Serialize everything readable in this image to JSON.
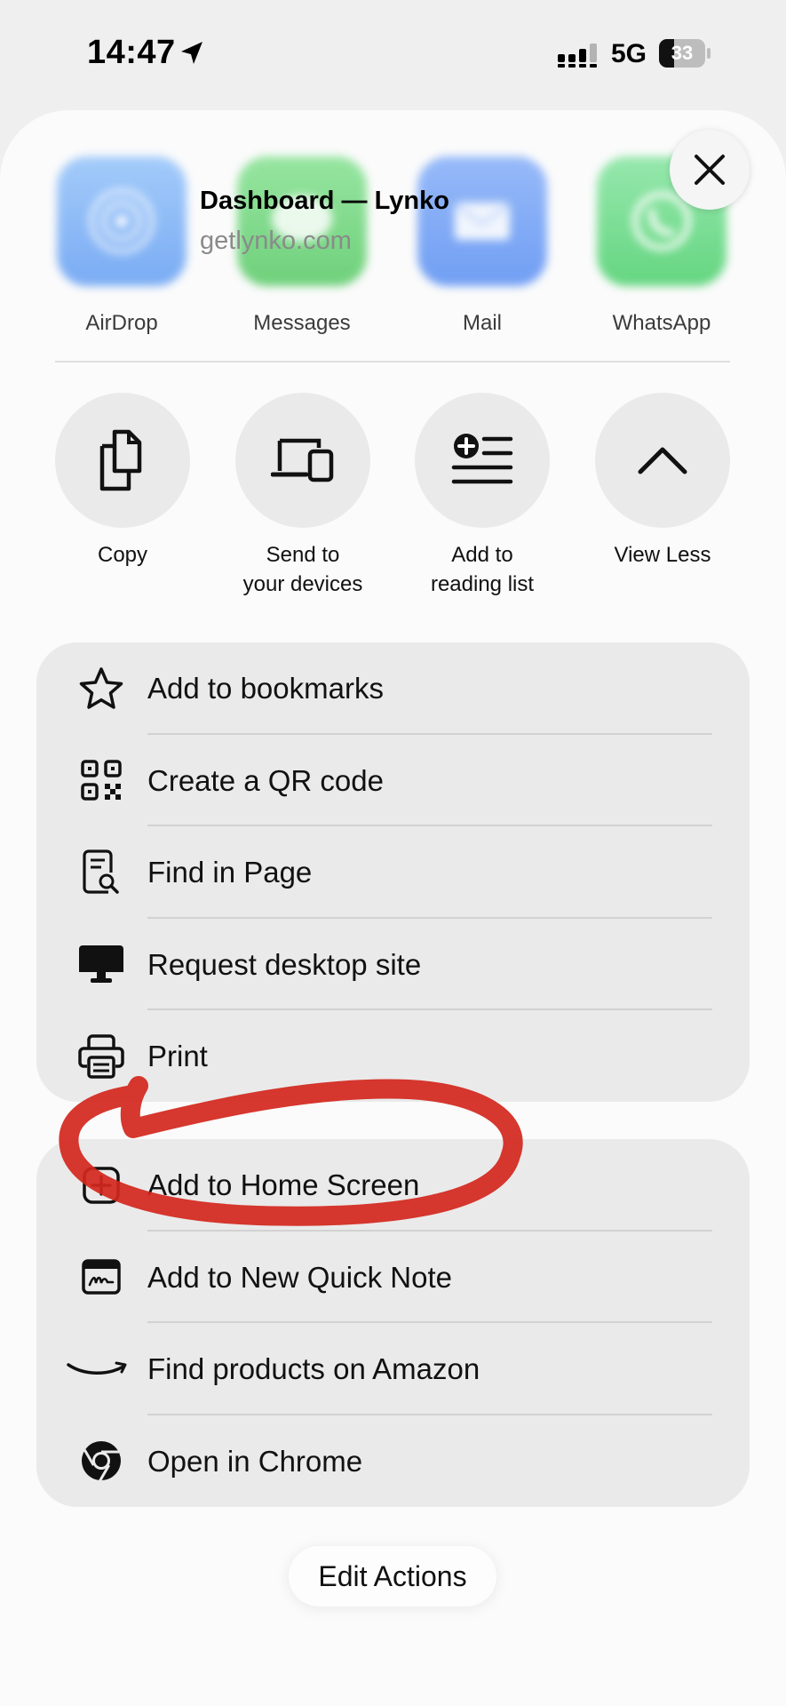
{
  "status_bar": {
    "time": "14:47",
    "network": "5G",
    "battery_level": "33"
  },
  "share_sheet": {
    "preview": {
      "title": "Dashboard — Lynko",
      "url": "getlynko.com"
    },
    "apps": [
      {
        "label": "AirDrop",
        "icon": "airdrop-icon"
      },
      {
        "label": "Messages",
        "icon": "messages-icon"
      },
      {
        "label": "Mail",
        "icon": "mail-icon"
      },
      {
        "label": "WhatsApp",
        "icon": "whatsapp-icon"
      }
    ],
    "quick_actions": [
      {
        "label": "Copy",
        "icon": "copy-icon"
      },
      {
        "label": "Send to\nyour devices",
        "icon": "devices-icon"
      },
      {
        "label": "Add to\nreading list",
        "icon": "reading-list-icon"
      },
      {
        "label": "View Less",
        "icon": "chevron-up-icon"
      }
    ],
    "menu_group_1": [
      {
        "label": "Add to bookmarks",
        "icon": "star-icon"
      },
      {
        "label": "Create a QR code",
        "icon": "qr-code-icon"
      },
      {
        "label": "Find in Page",
        "icon": "find-in-page-icon"
      },
      {
        "label": "Request desktop site",
        "icon": "desktop-icon"
      },
      {
        "label": "Print",
        "icon": "printer-icon"
      }
    ],
    "menu_group_2": [
      {
        "label": "Add to Home Screen",
        "icon": "add-square-icon"
      },
      {
        "label": "Add to New Quick Note",
        "icon": "quick-note-icon"
      },
      {
        "label": "Find products on Amazon",
        "icon": "amazon-icon"
      },
      {
        "label": "Open in Chrome",
        "icon": "chrome-icon"
      }
    ],
    "edit_actions_label": "Edit Actions"
  },
  "colors": {
    "airdrop": "#6aa8f5",
    "messages": "#5fd16a",
    "mail": "#5d95f5",
    "whatsapp": "#55d26e",
    "annotation_red": "#d2261c",
    "group_background": "#eaeaea"
  }
}
